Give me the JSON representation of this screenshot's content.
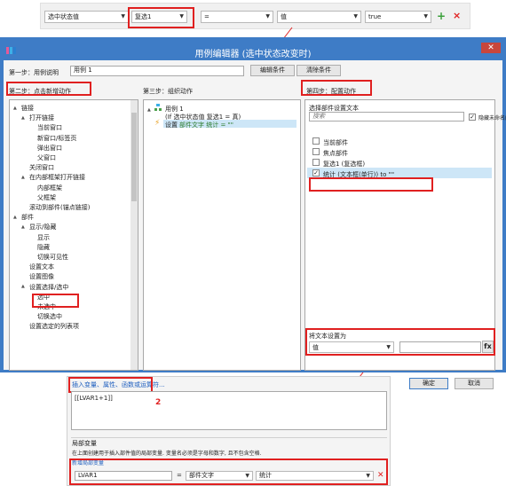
{
  "condition_bar": {
    "field1": "选中状态值",
    "field2": "复选1",
    "operator": "=",
    "field3": "值",
    "field4": "true",
    "add_label": "+",
    "delete_label": "×"
  },
  "window": {
    "title": "用例编辑器 (选中状态改变时)",
    "close_label": "✕"
  },
  "step1": {
    "label": "第一步：用例说明",
    "case_name": "用例 1",
    "edit_condition_button": "编辑条件",
    "clear_condition_button": "清除条件"
  },
  "step2": {
    "title": "第二步：点击新增动作",
    "tree": [
      {
        "label": "链接",
        "level": 0,
        "toggle": "▲"
      },
      {
        "label": "打开链接",
        "level": 1,
        "toggle": "▲"
      },
      {
        "label": "当前窗口",
        "level": 2,
        "toggle": ""
      },
      {
        "label": "新窗口/标签页",
        "level": 2,
        "toggle": ""
      },
      {
        "label": "弹出窗口",
        "level": 2,
        "toggle": ""
      },
      {
        "label": "父窗口",
        "level": 2,
        "toggle": ""
      },
      {
        "label": "关闭窗口",
        "level": 1,
        "toggle": ""
      },
      {
        "label": "在内部框架打开链接",
        "level": 1,
        "toggle": "▲"
      },
      {
        "label": "内部框架",
        "level": 2,
        "toggle": ""
      },
      {
        "label": "父框架",
        "level": 2,
        "toggle": ""
      },
      {
        "label": "滚动到部件(锚点链接)",
        "level": 1,
        "toggle": ""
      },
      {
        "label": "部件",
        "level": 0,
        "toggle": "▲"
      },
      {
        "label": "显示/隐藏",
        "level": 1,
        "toggle": "▲"
      },
      {
        "label": "显示",
        "level": 2,
        "toggle": ""
      },
      {
        "label": "隐藏",
        "level": 2,
        "toggle": ""
      },
      {
        "label": "切换可见性",
        "level": 2,
        "toggle": ""
      },
      {
        "label": "设置文本",
        "level": 1,
        "toggle": ""
      },
      {
        "label": "设置图像",
        "level": 1,
        "toggle": ""
      },
      {
        "label": "设置选择/选中",
        "level": 1,
        "toggle": "▲"
      },
      {
        "label": "选中",
        "level": 2,
        "toggle": ""
      },
      {
        "label": "未选中",
        "level": 2,
        "toggle": ""
      },
      {
        "label": "切换选中",
        "level": 2,
        "toggle": ""
      },
      {
        "label": "设置选定的列表项",
        "level": 1,
        "toggle": ""
      }
    ]
  },
  "step3": {
    "title": "第三步：组织动作",
    "case": "用例 1",
    "condition": "(If 选中状态值 复选1 = 真)",
    "action_prefix": "设置",
    "action_detail": "部件文字 统计 = \"\""
  },
  "step4": {
    "title": "第四步：配置动作",
    "subtitle": "选择部件设置文本",
    "search_placeholder": "搜索",
    "hide_unnamed": "隐藏未命名的",
    "widgets": [
      {
        "label": "当前部件",
        "checked": false
      },
      {
        "label": "焦点部件",
        "checked": false
      },
      {
        "label": "复选1 (复选框)",
        "checked": false
      },
      {
        "label": "统计 (文本框(单行)) to \"\"",
        "checked": true
      }
    ],
    "set_text_label": "将文本设置为",
    "value_type": "值",
    "value_input": "",
    "fx_label": "fx"
  },
  "footer": {
    "ok_button": "确定",
    "cancel_button": "取消"
  },
  "expression": {
    "insert_link": "插入变量、属性、函数或运算符...",
    "text": "[[LVAR1+1]]",
    "annotation_number": "2",
    "local_vars_title": "局部变量",
    "local_vars_desc": "在上面创建用于插入部件值的局部变量. 变量名必须是字母和数字, 且不包含空格.",
    "add_local_var_link": "新增局部变量",
    "var_name": "LVAR1",
    "var_eq": "=",
    "var_type": "部件文字",
    "var_target": "统计",
    "var_delete": "✕"
  },
  "colors": {
    "window_blue": "#3e7cc6",
    "highlight_red": "#e02020",
    "selection_blue": "#cde6f7"
  }
}
